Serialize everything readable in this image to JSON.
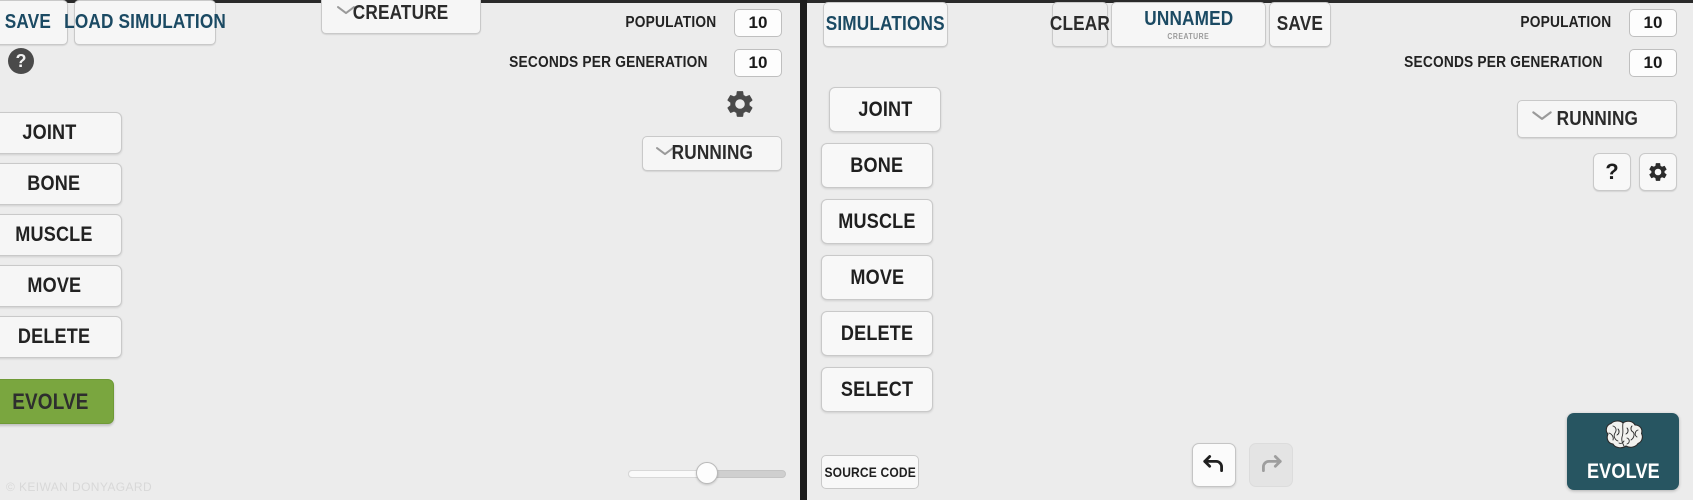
{
  "app": {
    "copyright": "© KEIWAN DONYAGARD"
  },
  "left_panel": {
    "toolbar": {
      "save_label": "SAVE",
      "load_simulation_label": "LOAD SIMULATION",
      "creature_dropdown_label": "CREATURE",
      "help_label": "?"
    },
    "settings": {
      "population_label": "POPULATION",
      "population_value": "10",
      "seconds_per_generation_label": "SECONDS PER GENERATION",
      "seconds_per_generation_value": "10",
      "gear_icon": "gear-icon",
      "state_dropdown_label": "RUNNING"
    },
    "tools": [
      {
        "label": "JOINT",
        "selected": true
      },
      {
        "label": "BONE",
        "selected": false
      },
      {
        "label": "MUSCLE",
        "selected": false
      },
      {
        "label": "MOVE",
        "selected": false
      },
      {
        "label": "DELETE",
        "selected": false
      }
    ],
    "evolve_label": "EVOLVE",
    "evolve_color": "#7aa63f",
    "slider": {
      "value_percent": 50
    }
  },
  "right_panel": {
    "toolbar": {
      "simulations_label": "SIMULATIONS",
      "clear_label": "CLEAR",
      "creature_name": "UNNAMED",
      "creature_name_sub": "CREATURE",
      "save_label": "SAVE"
    },
    "settings": {
      "population_label": "POPULATION",
      "population_value": "10",
      "seconds_per_generation_label": "SECONDS PER GENERATION",
      "seconds_per_generation_value": "10",
      "state_dropdown_label": "RUNNING",
      "help_label": "?",
      "gear_icon": "gear-icon"
    },
    "tools": [
      {
        "label": "JOINT",
        "selected": true
      },
      {
        "label": "BONE",
        "selected": false
      },
      {
        "label": "MUSCLE",
        "selected": false
      },
      {
        "label": "MOVE",
        "selected": false
      },
      {
        "label": "DELETE",
        "selected": false
      },
      {
        "label": "SELECT",
        "selected": false
      }
    ],
    "source_code_label": "SOURCE CODE",
    "undo_icon": "undo-arrow-icon",
    "redo_icon": "redo-arrow-icon",
    "evolve_label": "EVOLVE",
    "evolve_icon": "brain-icon",
    "evolve_color": "#275561"
  }
}
